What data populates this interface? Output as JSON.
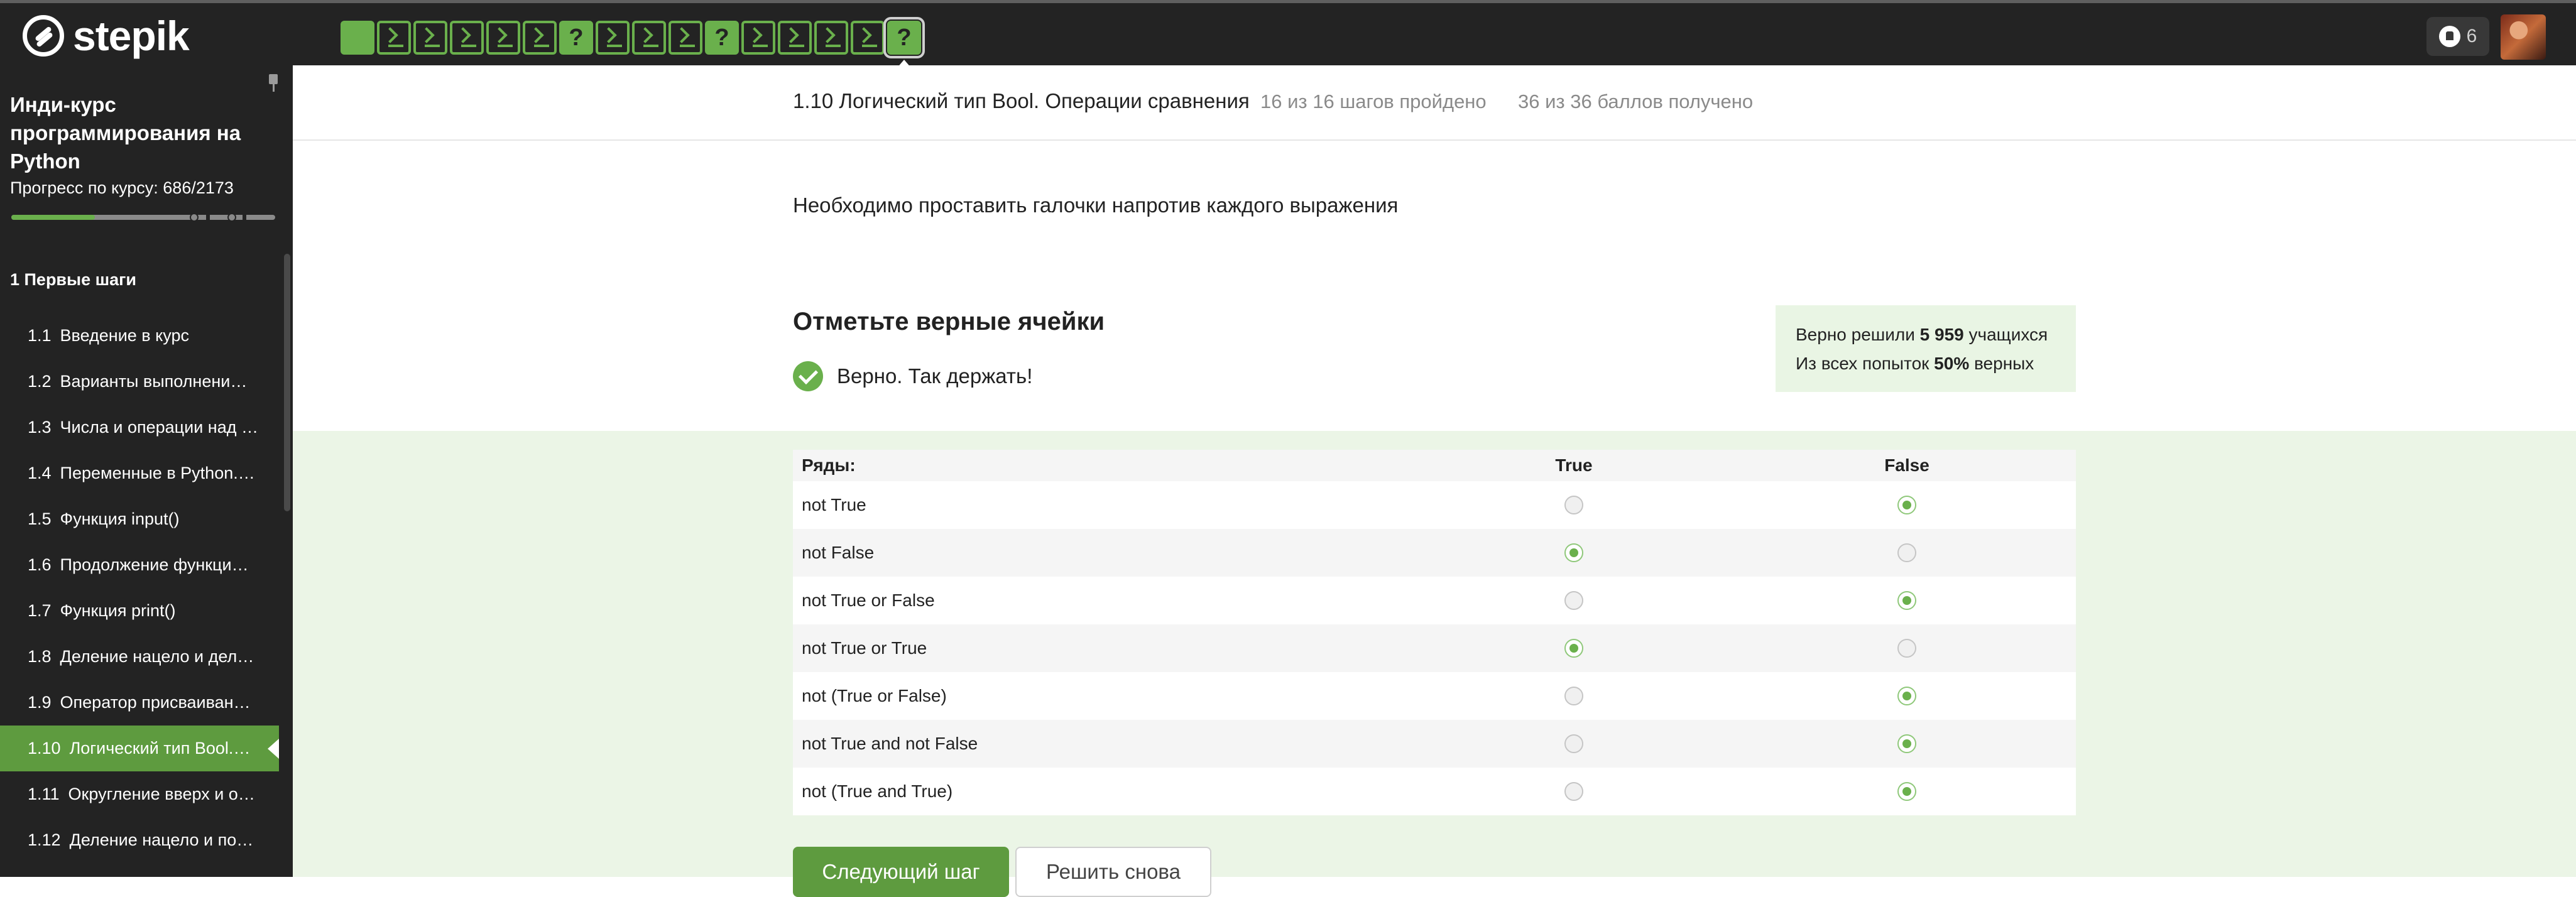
{
  "header": {
    "logo_text": "stepik",
    "steps": [
      {
        "type": "filled",
        "label": ""
      },
      {
        "type": "code",
        "label": ""
      },
      {
        "type": "code",
        "label": ""
      },
      {
        "type": "code",
        "label": ""
      },
      {
        "type": "code",
        "label": ""
      },
      {
        "type": "code",
        "label": ""
      },
      {
        "type": "quiz",
        "label": "?"
      },
      {
        "type": "code",
        "label": ""
      },
      {
        "type": "code",
        "label": ""
      },
      {
        "type": "code",
        "label": ""
      },
      {
        "type": "quiz",
        "label": "?"
      },
      {
        "type": "code",
        "label": ""
      },
      {
        "type": "code",
        "label": ""
      },
      {
        "type": "code",
        "label": ""
      },
      {
        "type": "code",
        "label": ""
      },
      {
        "type": "quiz-active",
        "label": "?"
      }
    ],
    "notifications_count": "6"
  },
  "sidebar": {
    "course_title": "Инди-курс программирования на Python",
    "progress_label": "Прогресс по курсу:  686/2173",
    "progress_fraction": 0.316,
    "module_title": "1  Первые шаги",
    "lessons": [
      {
        "num": "1.1",
        "title": "Введение в курс",
        "active": false
      },
      {
        "num": "1.2",
        "title": "Варианты выполнени…",
        "active": false
      },
      {
        "num": "1.3",
        "title": "Числа и операции над …",
        "active": false
      },
      {
        "num": "1.4",
        "title": "Переменные в Python.…",
        "active": false
      },
      {
        "num": "1.5",
        "title": "Функция input()",
        "active": false
      },
      {
        "num": "1.6",
        "title": "Продолжение функци…",
        "active": false
      },
      {
        "num": "1.7",
        "title": "Функция print()",
        "active": false
      },
      {
        "num": "1.8",
        "title": "Деление нацело и дел…",
        "active": false
      },
      {
        "num": "1.9",
        "title": "Оператор присваиван…",
        "active": false
      },
      {
        "num": "1.10",
        "title": "Логический тип Bool.…",
        "active": true
      },
      {
        "num": "1.11",
        "title": "Округление вверх и о…",
        "active": false
      },
      {
        "num": "1.12",
        "title": "Деление нацело и по…",
        "active": false
      }
    ]
  },
  "lesson_header": {
    "title": "1.10 Логический тип Bool. Операции сравнения",
    "steps_done": "16 из 16 шагов пройдено",
    "points": "36 из 36 баллов  получено"
  },
  "step": {
    "instruction": "Необходимо проставить галочки напротив каждого выражения",
    "quiz_title": "Отметьте верные ячейки",
    "correct_text": "Верно. Так держать!",
    "stats": {
      "line1_prefix": "Верно решили ",
      "line1_count": "5 959",
      "line1_suffix": " учащихся",
      "line2_prefix": "Из всех попыток ",
      "line2_percent": "50%",
      "line2_suffix": " верных"
    },
    "table": {
      "row_header": "Ряды:",
      "col_true": "True",
      "col_false": "False",
      "rows": [
        {
          "label": "not True",
          "answer": "False"
        },
        {
          "label": "not False",
          "answer": "True"
        },
        {
          "label": "not True or False",
          "answer": "False"
        },
        {
          "label": "not True or True",
          "answer": "True"
        },
        {
          "label": "not (True or False)",
          "answer": "False"
        },
        {
          "label": "not True and not False",
          "answer": "False"
        },
        {
          "label": "not (True and True)",
          "answer": "False"
        }
      ]
    },
    "next_button": "Следующий шаг",
    "retry_button": "Решить снова"
  },
  "colors": {
    "accent": "#6ab04c",
    "active_lesson": "#5e9b3f",
    "dark": "#232323",
    "success_bg": "#ebf5e6"
  }
}
